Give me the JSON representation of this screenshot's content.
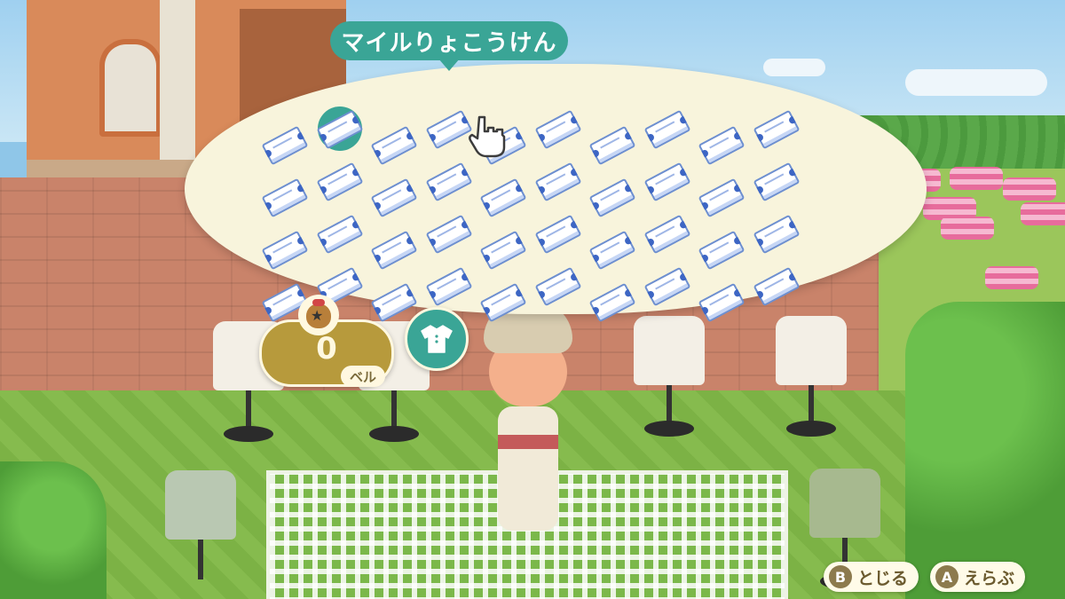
{
  "menu": {
    "title": "マイルりょこうけん",
    "item_icon": "nook-miles-ticket-icon",
    "selected_index": 1,
    "grid": {
      "columns": 10,
      "rows": 4,
      "filled_slots": 40
    }
  },
  "wallet": {
    "bells_value": "0",
    "bells_unit": "ベル",
    "bag_icon": "bell-bag-icon"
  },
  "clothing_button": {
    "icon": "shirt-icon"
  },
  "button_hints": [
    {
      "key": "B",
      "label": "とじる"
    },
    {
      "key": "A",
      "label": "えらぶ"
    }
  ],
  "colors": {
    "accent": "#3aa596",
    "bubble": "#f8f4dc",
    "bells": "#b79a3c",
    "ticket_blue": "#3d66c4"
  }
}
